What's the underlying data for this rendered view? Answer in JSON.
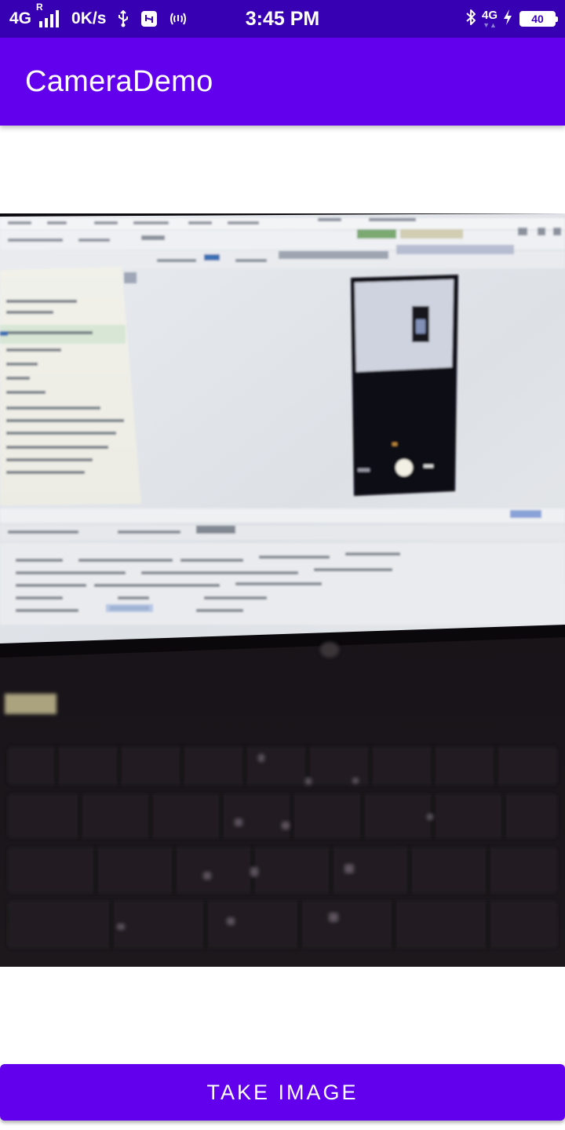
{
  "status_bar": {
    "network_type": "4G",
    "roaming_indicator": "R",
    "data_speed": "0K/s",
    "time": "3:45 PM",
    "network_type_right": "4G",
    "battery_level": "40",
    "icons": [
      "signal-bars-icon",
      "usb-icon",
      "usb-debug-icon",
      "hotspot-icon",
      "bluetooth-icon",
      "data-arrows-icon",
      "charging-bolt-icon",
      "battery-icon"
    ]
  },
  "app_bar": {
    "title": "CameraDemo"
  },
  "image_preview": {
    "description_icon": "photo-preview"
  },
  "actions": {
    "take_image_label": "TAKE IMAGE"
  },
  "colors": {
    "status_bar": "#3700B3",
    "primary": "#6200EE",
    "background": "#FFFFFF",
    "on_primary": "#FFFFFF"
  }
}
